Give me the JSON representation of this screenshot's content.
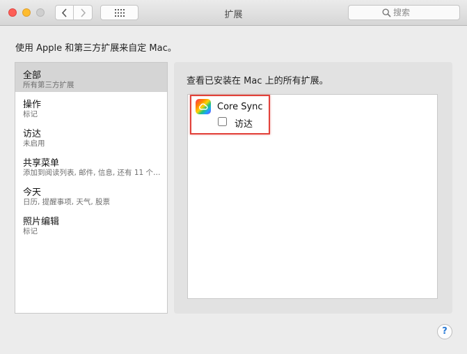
{
  "window": {
    "title": "扩展",
    "search_placeholder": "搜索",
    "help_label": "?"
  },
  "intro": "使用 Apple 和第三方扩展来自定 Mac。",
  "sidebar": {
    "items": [
      {
        "title": "全部",
        "subtitle": "所有第三方扩展",
        "selected": true
      },
      {
        "title": "操作",
        "subtitle": "标记",
        "selected": false
      },
      {
        "title": "访达",
        "subtitle": "未启用",
        "selected": false
      },
      {
        "title": "共享菜单",
        "subtitle": "添加到阅读列表, 邮件, 信息, 还有 11 个…",
        "selected": false
      },
      {
        "title": "今天",
        "subtitle": "日历, 提醒事项, 天气, 股票",
        "selected": false
      },
      {
        "title": "照片编辑",
        "subtitle": "标记",
        "selected": false
      }
    ]
  },
  "panel": {
    "header": "查看已安装在 Mac 上的所有扩展。",
    "extensions": [
      {
        "app_name": "Core Sync",
        "icon": "creative-cloud-icon",
        "option_label": "访达",
        "checked": false
      }
    ]
  },
  "colors": {
    "highlight": "#e2413a",
    "selection": "#d5d5d5"
  }
}
